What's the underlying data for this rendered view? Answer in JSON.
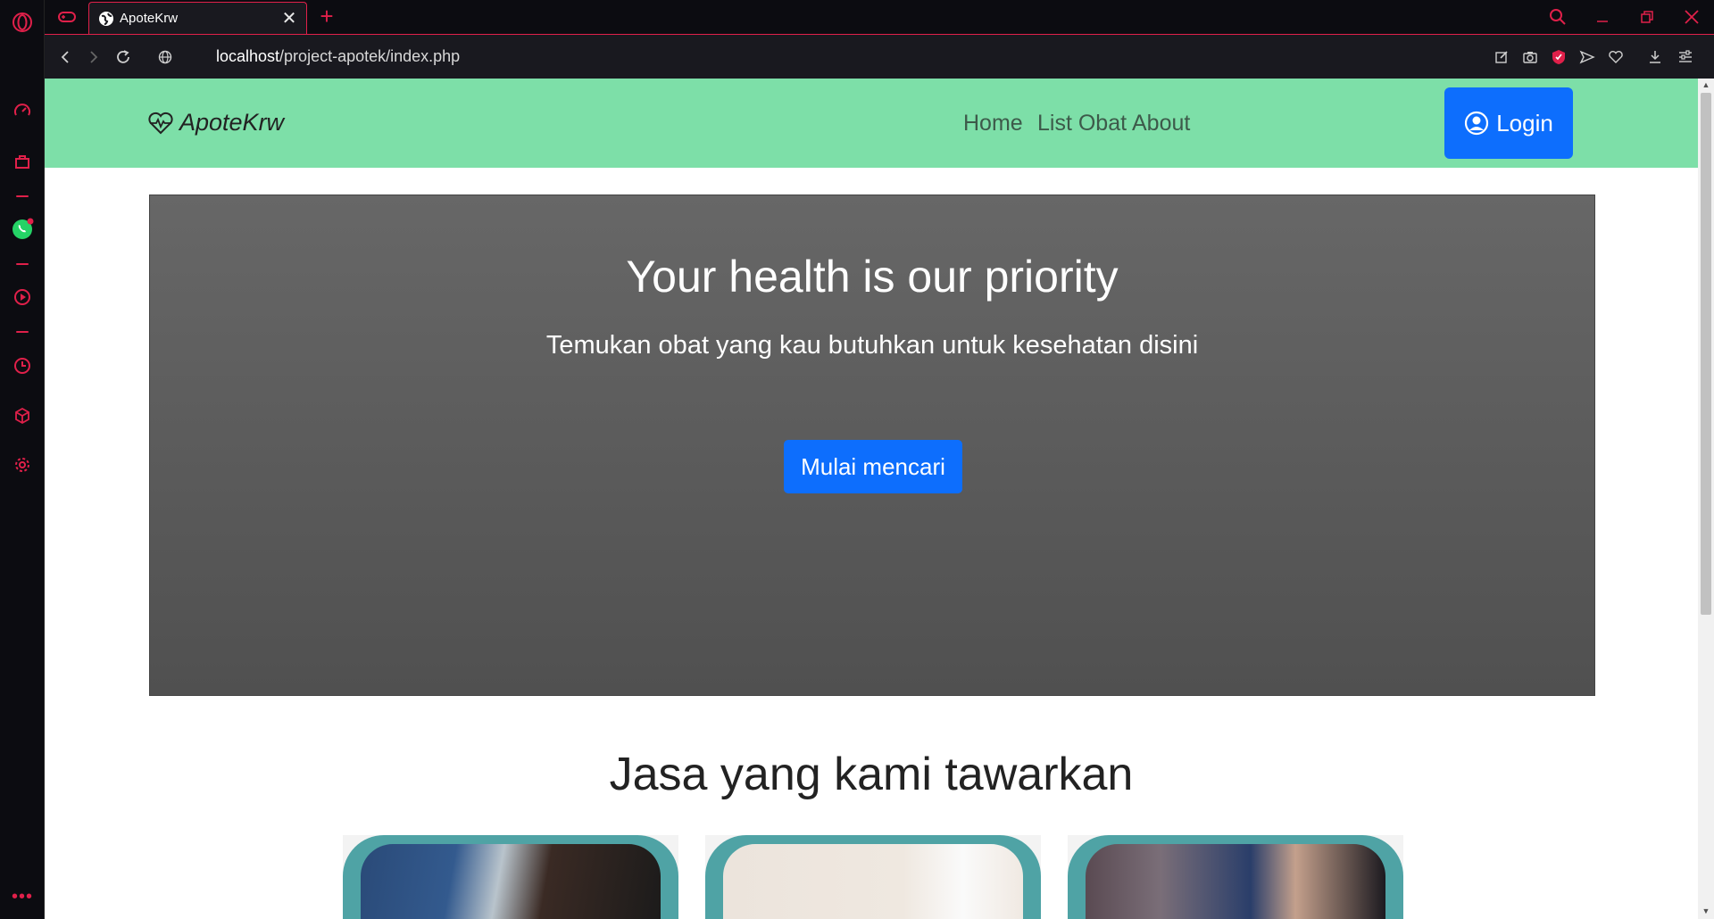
{
  "browser": {
    "tab_title": "ApoteKrw",
    "url_host": "localhost",
    "url_path": "/project-apotek/index.php",
    "accent": "#e0204a",
    "sidebar_icons": [
      "opera-logo-icon",
      "speed-dial-icon",
      "shopping-bag-icon",
      "whatsapp-icon",
      "player-icon",
      "history-icon",
      "extensions-cube-icon",
      "settings-gear-icon",
      "more-icon"
    ],
    "toolbar_icons": [
      "snapshot-edit-icon",
      "camera-icon",
      "vpn-shield-icon",
      "send-icon",
      "heart-icon",
      "download-icon",
      "easy-setup-icon"
    ]
  },
  "site": {
    "brand": "ApoteKrw",
    "nav": {
      "home": "Home",
      "list_obat": "List Obat",
      "about": "About",
      "login": "Login"
    },
    "navbar_color": "#7ddfa8",
    "primary_color": "#0d6efd",
    "hero": {
      "title": "Your health is our priority",
      "subtitle": "Temukan obat yang kau butuhkan untuk kesehatan disini",
      "cta": "Mulai mencari"
    },
    "services": {
      "title": "Jasa yang kami tawarkan",
      "card_frame_color": "#4fa3a5"
    }
  }
}
